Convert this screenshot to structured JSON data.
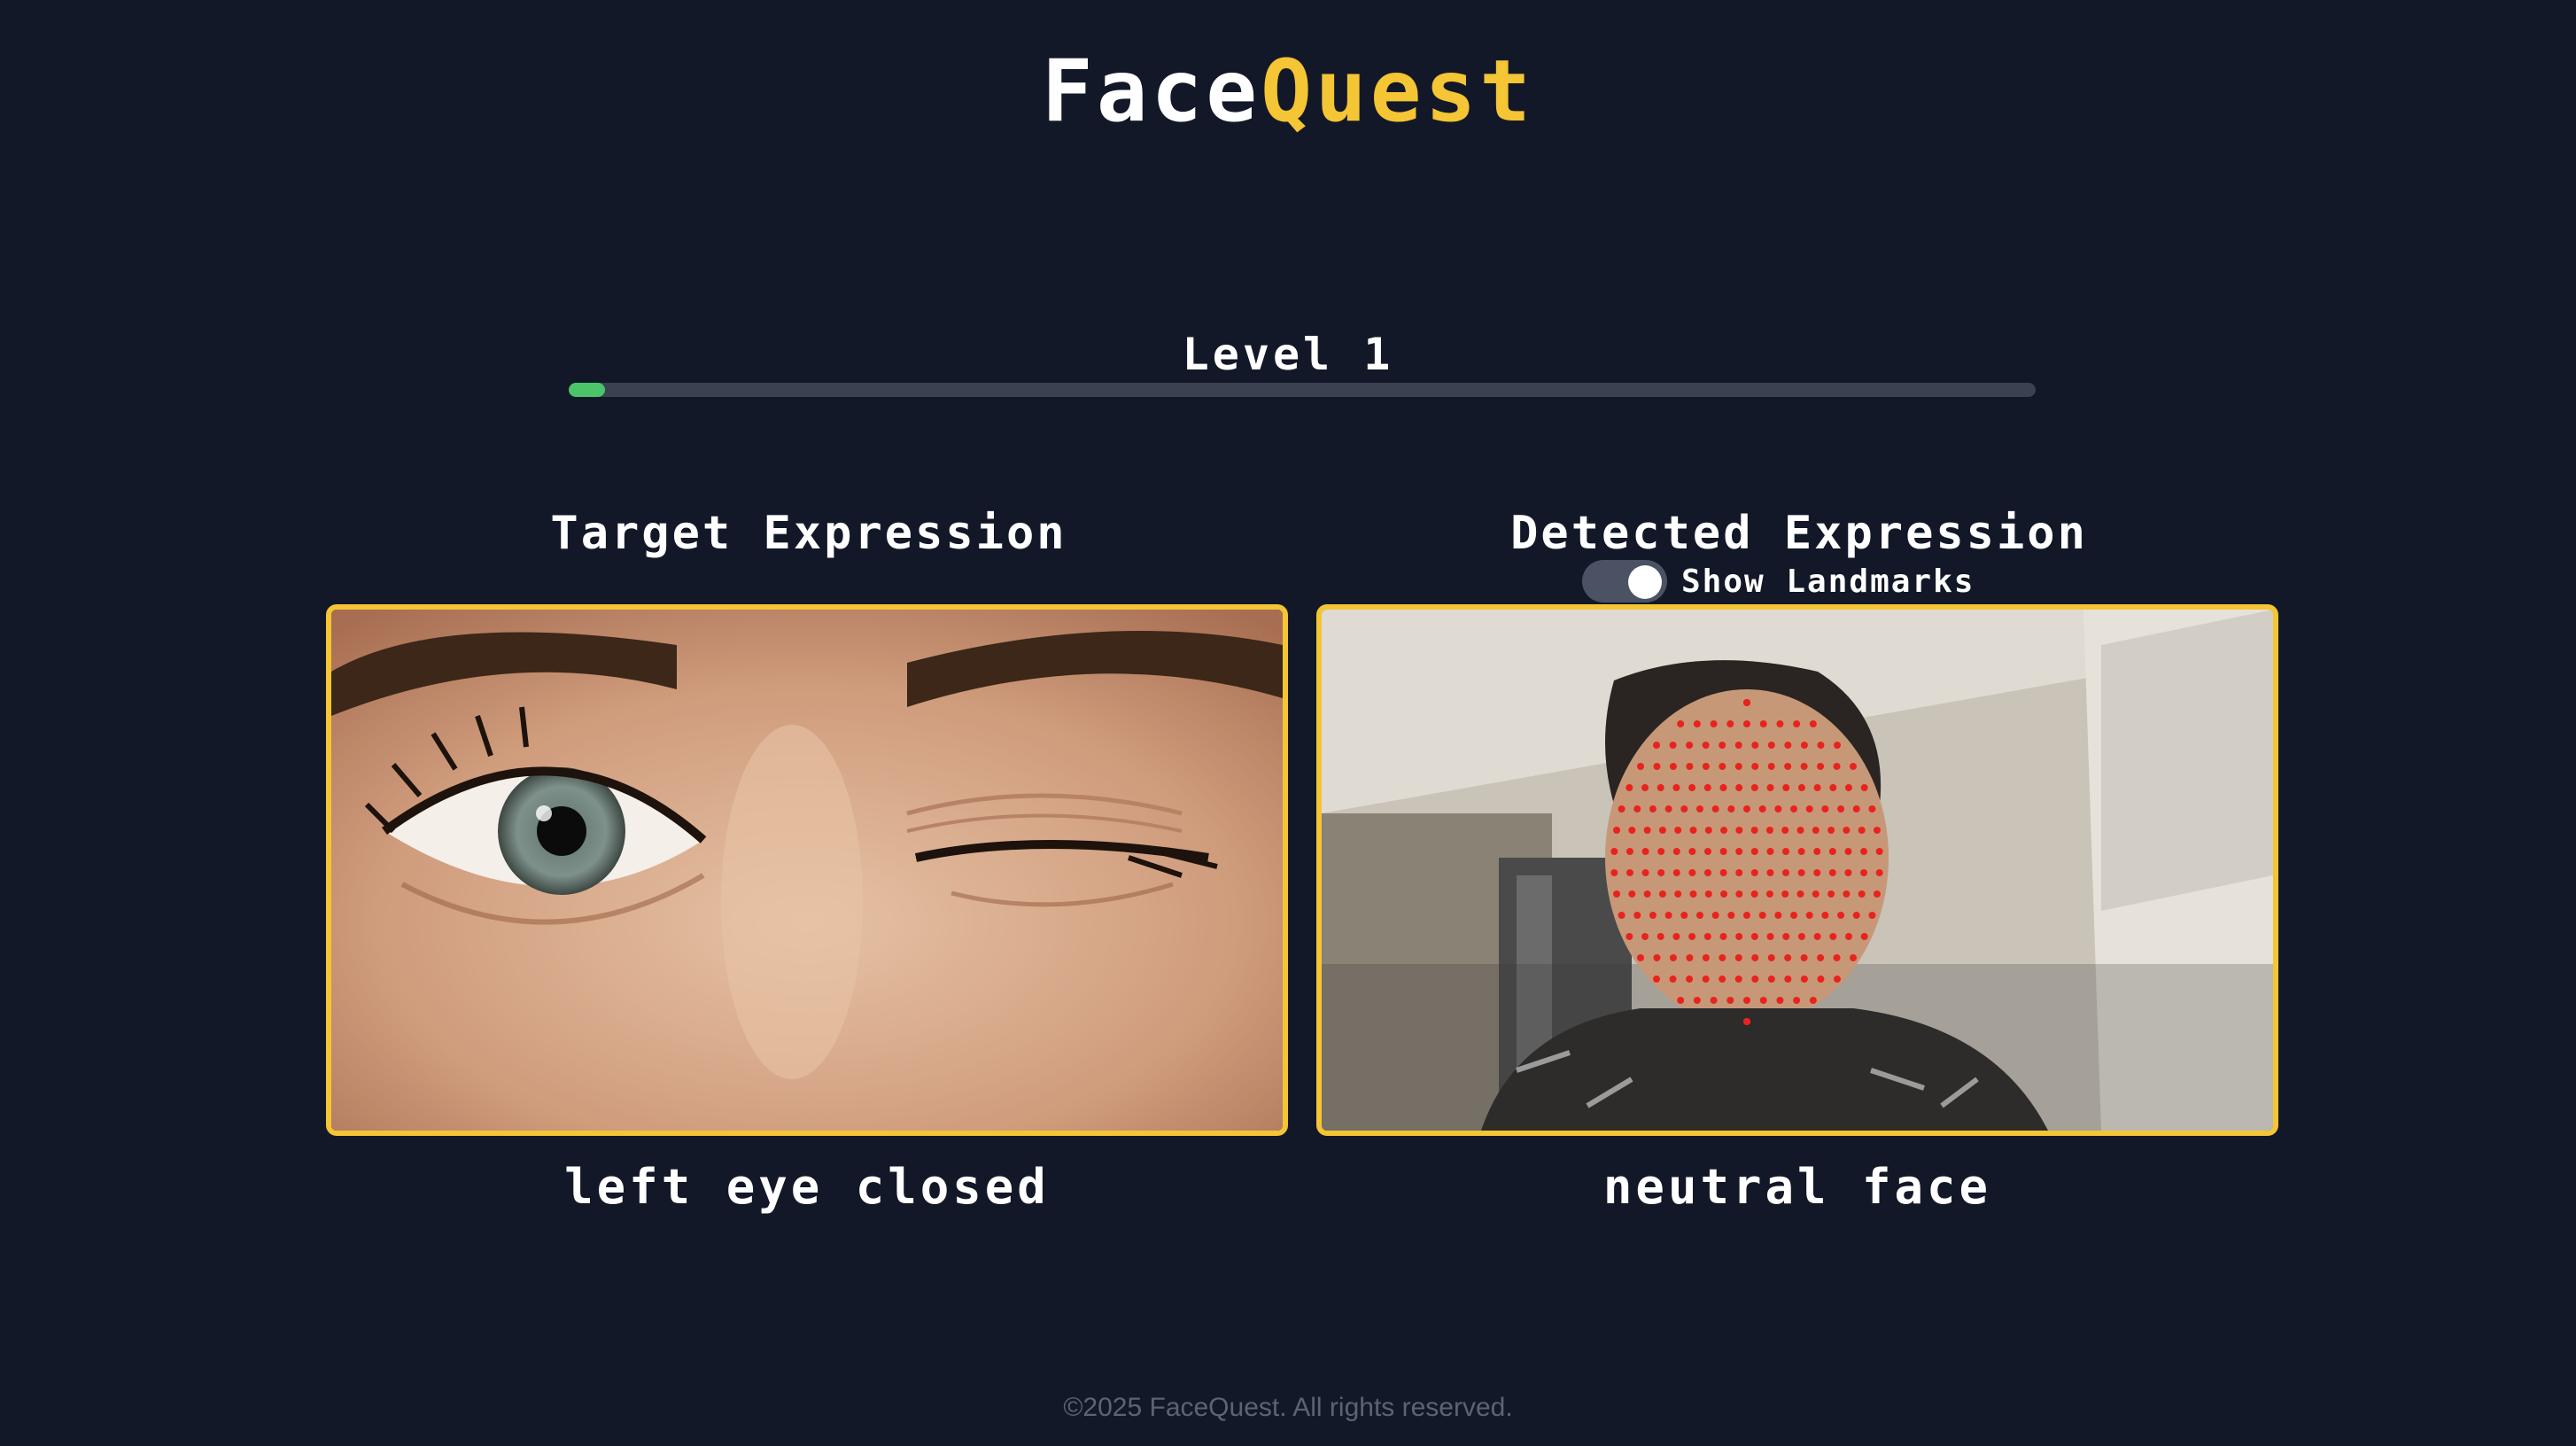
{
  "header": {
    "title_part1": "Face",
    "title_part2": "Quest"
  },
  "level": {
    "label": "Level 1",
    "progress": 0.025
  },
  "target": {
    "heading": "Target Expression",
    "caption": "left eye closed"
  },
  "detected": {
    "heading": "Detected Expression",
    "toggle_label": "Show Landmarks",
    "toggle_on": true,
    "caption": "neutral face"
  },
  "footer": {
    "text": "©2025 FaceQuest. All rights reserved."
  },
  "colors": {
    "background": "#131828",
    "accent": "#f4c534",
    "progress_fill": "#4cc46a",
    "landmark": "#e8231e"
  }
}
